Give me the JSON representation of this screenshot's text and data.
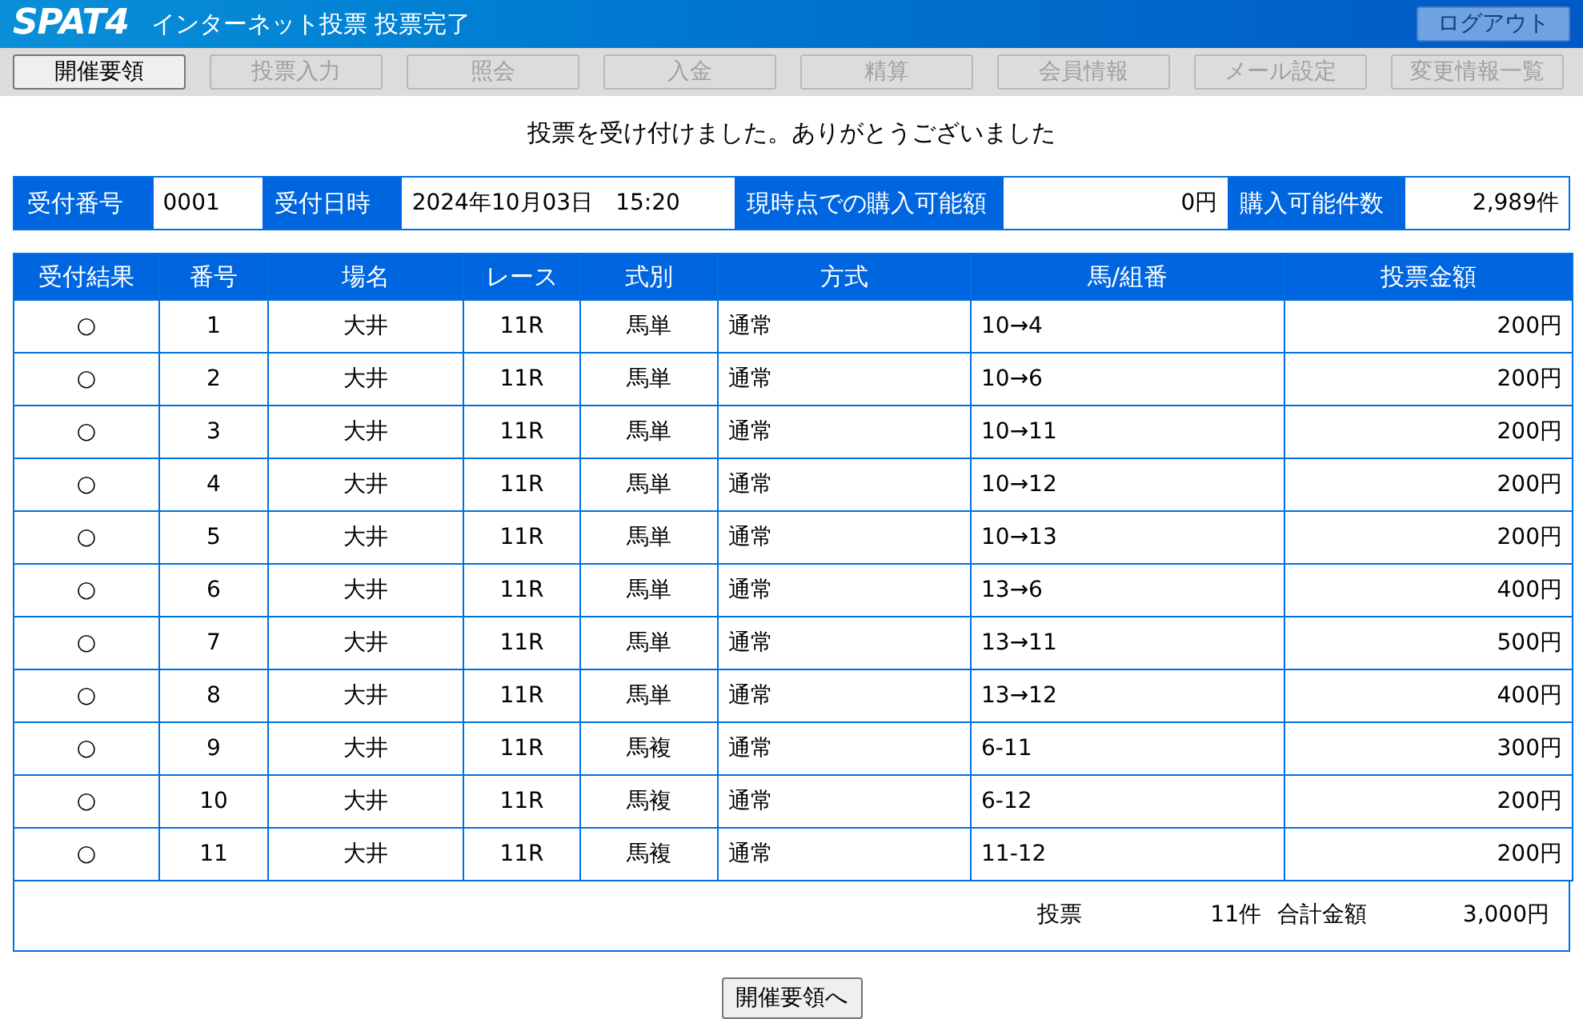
{
  "header": {
    "logo": "SPAT4",
    "title": "インターネット投票 投票完了",
    "logout": {
      "label": "ログアウト",
      "disabled": true
    }
  },
  "nav": [
    {
      "label": "開催要領",
      "disabled": false
    },
    {
      "label": "投票入力",
      "disabled": true
    },
    {
      "label": "照会",
      "disabled": true
    },
    {
      "label": "入金",
      "disabled": true
    },
    {
      "label": "精算",
      "disabled": true
    },
    {
      "label": "会員情報",
      "disabled": true
    },
    {
      "label": "メール設定",
      "disabled": true
    },
    {
      "label": "変更情報一覧",
      "disabled": true
    }
  ],
  "message": "投票を受け付けました。ありがとうございました",
  "info": [
    {
      "label": "受付番号",
      "value": "0001"
    },
    {
      "label": "受付日時",
      "value": "2024年10月03日　15:20"
    },
    {
      "label": "現時点での購入可能額",
      "value": "0円"
    },
    {
      "label": "購入可能件数",
      "value": "2,989件"
    }
  ],
  "table": {
    "columns": [
      "受付結果",
      "番号",
      "場名",
      "レース",
      "式別",
      "方式",
      "馬/組番",
      "投票金額"
    ],
    "rows": [
      [
        "○",
        "1",
        "大井",
        "11R",
        "馬単",
        "通常",
        "10→4",
        "200円"
      ],
      [
        "○",
        "2",
        "大井",
        "11R",
        "馬単",
        "通常",
        "10→6",
        "200円"
      ],
      [
        "○",
        "3",
        "大井",
        "11R",
        "馬単",
        "通常",
        "10→11",
        "200円"
      ],
      [
        "○",
        "4",
        "大井",
        "11R",
        "馬単",
        "通常",
        "10→12",
        "200円"
      ],
      [
        "○",
        "5",
        "大井",
        "11R",
        "馬単",
        "通常",
        "10→13",
        "200円"
      ],
      [
        "○",
        "6",
        "大井",
        "11R",
        "馬単",
        "通常",
        "13→6",
        "400円"
      ],
      [
        "○",
        "7",
        "大井",
        "11R",
        "馬単",
        "通常",
        "13→11",
        "500円"
      ],
      [
        "○",
        "8",
        "大井",
        "11R",
        "馬単",
        "通常",
        "13→12",
        "400円"
      ],
      [
        "○",
        "9",
        "大井",
        "11R",
        "馬複",
        "通常",
        "6-11",
        "300円"
      ],
      [
        "○",
        "10",
        "大井",
        "11R",
        "馬複",
        "通常",
        "6-12",
        "200円"
      ],
      [
        "○",
        "11",
        "大井",
        "11R",
        "馬複",
        "通常",
        "11-12",
        "200円"
      ]
    ]
  },
  "summary": {
    "votes_label": "投票",
    "votes": "11件",
    "total_label": "合計金額",
    "total": "3,000円"
  },
  "back_button": "開催要領へ"
}
